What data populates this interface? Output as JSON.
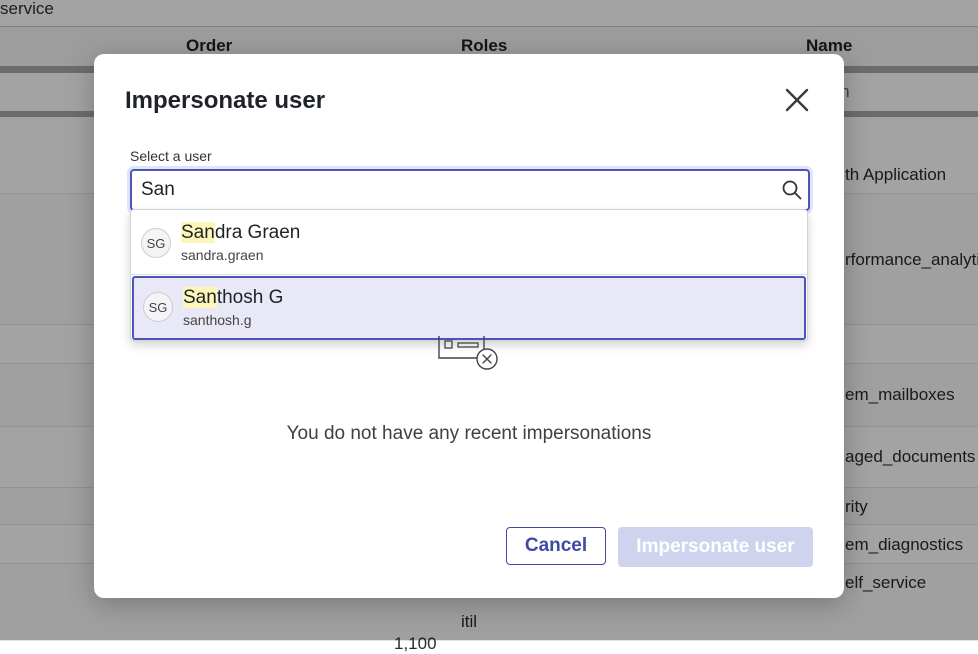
{
  "background": {
    "breadcrumb": "service",
    "columns": {
      "order": "Order",
      "roles": "Roles",
      "name": "Name"
    },
    "search_placeholder": "rch",
    "names": [
      "th Application",
      "rformance_analytics",
      "em_mailboxes",
      "aged_documents",
      "rity",
      "em_diagnostics",
      "elf_service"
    ],
    "roles_bottom": "itil",
    "order_bottom": "1,100"
  },
  "modal": {
    "title": "Impersonate user",
    "field_label": "Select a user",
    "search_value": "San",
    "options": [
      {
        "initials": "SG",
        "match": "San",
        "rest": "dra Graen",
        "username": "sandra.graen"
      },
      {
        "initials": "SG",
        "match": "San",
        "rest": "thosh G",
        "username": "santhosh.g"
      }
    ],
    "empty_message": "You do not have any recent impersonations",
    "cancel_label": "Cancel",
    "submit_label": "Impersonate user"
  },
  "colors": {
    "accent": "#4a55b8",
    "highlight": "#fdf6b9",
    "selected_option": "#e8e8f6",
    "disabled_button": "#cfd3ee"
  },
  "icons": {
    "close": "close-icon",
    "search": "search-icon",
    "empty_state": "empty-inbox-icon"
  }
}
